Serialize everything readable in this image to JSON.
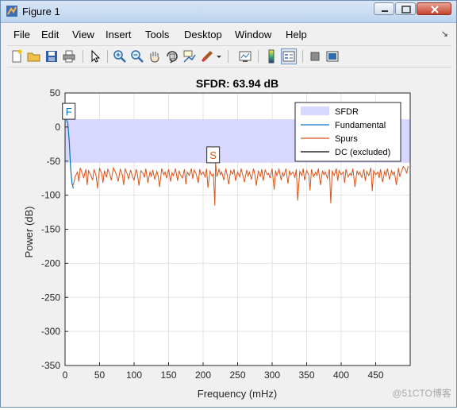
{
  "window": {
    "title": "Figure 1"
  },
  "menu": [
    "File",
    "Edit",
    "View",
    "Insert",
    "Tools",
    "Desktop",
    "Window",
    "Help"
  ],
  "menu_arrow": "↘",
  "toolbar": {
    "icons": [
      "new-figure-icon",
      "open-file-icon",
      "save-icon",
      "print-icon",
      "pointer-icon",
      "zoom-in-icon",
      "zoom-out-icon",
      "pan-icon",
      "rotate-3d-icon",
      "data-cursor-icon",
      "brush-icon",
      "brush-dropdown-icon",
      "link-plot-icon",
      "insert-colorbar-icon",
      "insert-legend-icon",
      "hide-plot-tools-icon",
      "show-plot-tools-icon"
    ]
  },
  "chart_data": {
    "type": "line",
    "title": "SFDR:  63.94 dB",
    "xlabel": "Frequency (mHz)",
    "ylabel": "Power (dB)",
    "xlim": [
      0,
      500
    ],
    "ylim": [
      -350,
      50
    ],
    "xticks": [
      "0",
      "50",
      "100",
      "150",
      "200",
      "250",
      "300",
      "350",
      "400",
      "450"
    ],
    "yticks": [
      "50",
      "0",
      "-50",
      "-100",
      "-150",
      "-200",
      "-250",
      "-300",
      "-350"
    ],
    "grid": true,
    "legend_placement": "top-right",
    "legend": [
      "SFDR",
      "Fundamental",
      "Spurs",
      "DC (excluded)"
    ],
    "colors": {
      "sfdr": "#d8d8ff",
      "fundamental": "#0072bd",
      "spurs": "#d95319",
      "dc": "#000000"
    },
    "sfdr_band": [
      -52.5,
      11.44
    ],
    "markers": [
      {
        "label": "F",
        "x": 2,
        "y": 11.44,
        "color": "#0072bd"
      },
      {
        "label": "S",
        "x": 218,
        "y": -52.5,
        "color": "#d95319"
      }
    ],
    "fundamental": {
      "x": [
        0,
        2,
        4,
        6,
        8,
        10,
        12
      ],
      "y": [
        12,
        11.4,
        5,
        -20,
        -60,
        -82,
        -90
      ]
    },
    "spurs": {
      "x": [
        12,
        15,
        18,
        20,
        22,
        25,
        27,
        30,
        32,
        34,
        37,
        40,
        42,
        45,
        47,
        50,
        53,
        55,
        57,
        60,
        62,
        65,
        67,
        70,
        73,
        75,
        77,
        80,
        83,
        85,
        87,
        90,
        92,
        95,
        97,
        100,
        103,
        105,
        107,
        110,
        113,
        115,
        117,
        120,
        123,
        125,
        127,
        130,
        133,
        135,
        137,
        140,
        143,
        145,
        147,
        150,
        153,
        155,
        157,
        160,
        163,
        165,
        167,
        170,
        173,
        175,
        177,
        180,
        183,
        185,
        187,
        190,
        193,
        195,
        197,
        200,
        203,
        205,
        207,
        210,
        213,
        215,
        217,
        218,
        220,
        223,
        225,
        227,
        230,
        233,
        235,
        237,
        240,
        243,
        245,
        247,
        250,
        253,
        255,
        257,
        260,
        263,
        265,
        267,
        270,
        273,
        275,
        277,
        280,
        283,
        285,
        287,
        290,
        293,
        295,
        297,
        300,
        303,
        305,
        307,
        310,
        313,
        315,
        317,
        320,
        323,
        325,
        327,
        330,
        333,
        335,
        337,
        340,
        343,
        345,
        347,
        350,
        353,
        355,
        357,
        360,
        363,
        365,
        367,
        370,
        373,
        375,
        377,
        380,
        383,
        385,
        387,
        390,
        393,
        395,
        397,
        400,
        403,
        405,
        407,
        410,
        413,
        415,
        417,
        420,
        423,
        425,
        427,
        430,
        433,
        435,
        437,
        440,
        443,
        445,
        447,
        450,
        453,
        455,
        457,
        460,
        463,
        465,
        467,
        470,
        473,
        475,
        477,
        480,
        483,
        485,
        487,
        490,
        493,
        495,
        497,
        499
      ],
      "y": [
        -85,
        -72,
        -66,
        -80,
        -60,
        -68,
        -75,
        -62,
        -85,
        -64,
        -70,
        -78,
        -62,
        -72,
        -90,
        -60,
        -68,
        -82,
        -64,
        -74,
        -62,
        -70,
        -78,
        -60,
        -66,
        -72,
        -80,
        -62,
        -70,
        -85,
        -61,
        -69,
        -76,
        -63,
        -71,
        -78,
        -62,
        -70,
        -86,
        -64,
        -68,
        -74,
        -61,
        -82,
        -66,
        -72,
        -63,
        -77,
        -65,
        -72,
        -88,
        -61,
        -70,
        -66,
        -75,
        -62,
        -80,
        -67,
        -71,
        -61,
        -79,
        -64,
        -70,
        -75,
        -62,
        -84,
        -66,
        -71,
        -61,
        -76,
        -63,
        -69,
        -82,
        -62,
        -70,
        -66,
        -73,
        -61,
        -89,
        -65,
        -72,
        -69,
        -115,
        -52.5,
        -73,
        -62,
        -70,
        -66,
        -78,
        -61,
        -71,
        -84,
        -64,
        -69,
        -62,
        -79,
        -66,
        -73,
        -61,
        -69,
        -81,
        -63,
        -72,
        -66,
        -77,
        -61,
        -70,
        -86,
        -64,
        -73,
        -62,
        -79,
        -63,
        -70,
        -68,
        -75,
        -61,
        -92,
        -64,
        -71,
        -62,
        -78,
        -67,
        -72,
        -61,
        -83,
        -64,
        -70,
        -66,
        -74,
        -62,
        -108,
        -65,
        -71,
        -61,
        -78,
        -64,
        -70,
        -93,
        -62,
        -73,
        -66,
        -71,
        -61,
        -85,
        -64,
        -70,
        -66,
        -75,
        -62,
        -112,
        -65,
        -71,
        -61,
        -79,
        -64,
        -70,
        -66,
        -82,
        -62,
        -73,
        -68,
        -71,
        -61,
        -88,
        -64,
        -70,
        -66,
        -74,
        -62,
        -79,
        -65,
        -71,
        -60,
        -94,
        -64,
        -70,
        -66,
        -75,
        -62,
        -81,
        -65,
        -71,
        -61,
        -77,
        -64,
        -70,
        -66,
        -85,
        -60,
        -73,
        -66,
        -58,
        -62,
        -68,
        -57
      ]
    },
    "dc": {
      "x": [
        0,
        0.5
      ],
      "y": [
        12,
        12
      ]
    }
  },
  "watermark": "@51CTO博客"
}
